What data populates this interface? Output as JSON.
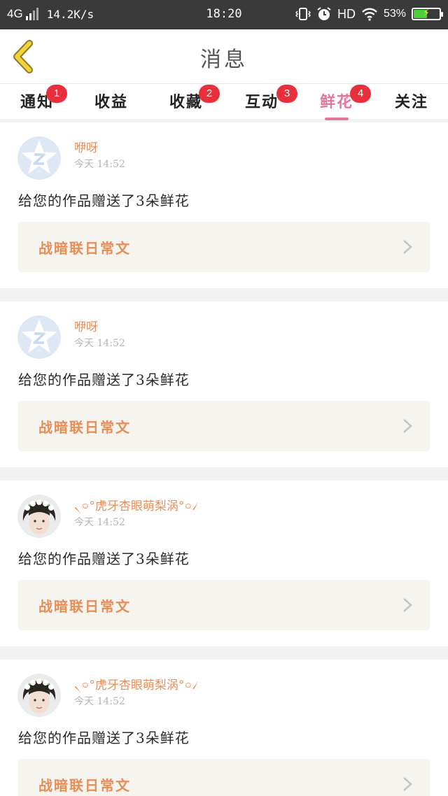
{
  "status_bar": {
    "network": "4G",
    "speed": "14.2K/s",
    "time": "18:20",
    "hd": "HD",
    "battery_percent": "53%",
    "battery_level": 0.53
  },
  "header": {
    "title": "消息"
  },
  "tabs": [
    {
      "label": "通知",
      "badge": "1"
    },
    {
      "label": "收益"
    },
    {
      "label": "收藏",
      "badge": "2"
    },
    {
      "label": "互动",
      "badge": "3"
    },
    {
      "label": "鲜花",
      "badge": "4",
      "active": true
    },
    {
      "label": "关注"
    }
  ],
  "notifications": [
    {
      "username": "咿呀",
      "time": "今天 14:52",
      "message": "给您的作品赠送了3朵鲜花",
      "work": "战暗联日常文",
      "avatar": "default-star-avatar"
    },
    {
      "username": "咿呀",
      "time": "今天 14:52",
      "message": "给您的作品赠送了3朵鲜花",
      "work": "战暗联日常文",
      "avatar": "default-star-avatar"
    },
    {
      "username": "৲০°虎牙杏眼萌梨涡°০৴",
      "time": "今天 14:52",
      "message": "给您的作品赠送了3朵鲜花",
      "work": "战暗联日常文",
      "avatar": "flower-crown-photo"
    },
    {
      "username": "৲০°虎牙杏眼萌梨涡°০৴",
      "time": "今天 14:52",
      "message": "给您的作品赠送了3朵鲜花",
      "work": "战暗联日常文",
      "avatar": "flower-crown-photo"
    }
  ],
  "colors": {
    "accent_pink": "#e1779c",
    "badge_red": "#e8303c",
    "username_orange": "#e88d59",
    "work_orange": "#ea8c53",
    "back_yellow": "#f1d23a"
  }
}
